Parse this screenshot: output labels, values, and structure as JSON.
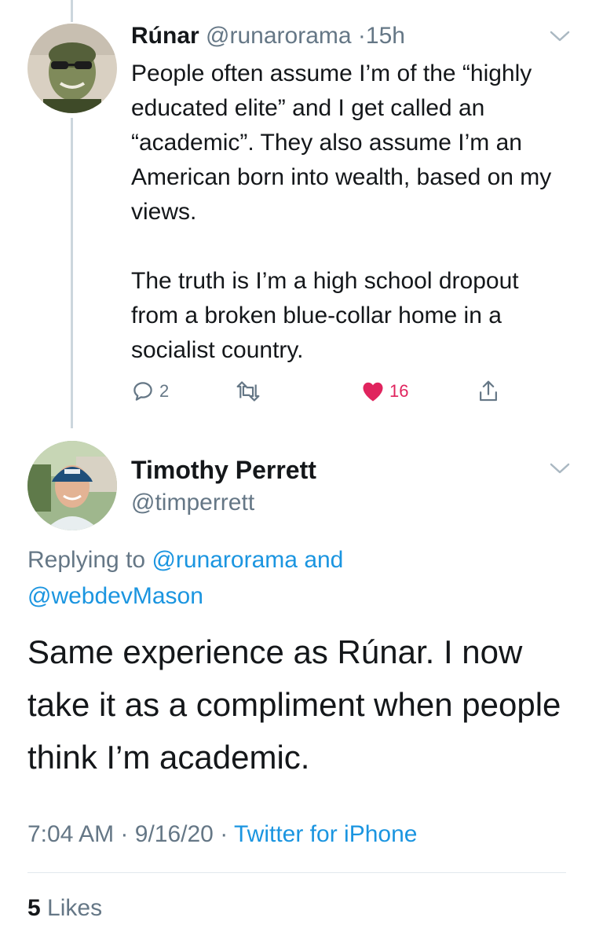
{
  "parent_tweet": {
    "author_name": "Rúnar",
    "author_handle": "@runarorama",
    "separator": "·",
    "time_ago": "15h",
    "paragraphs": [
      "People often assume I’m of the “highly educated elite” and I get called an “academic”. They also assume I’m an American born into wealth, based on my views.",
      "The truth is I’m a high school dropout from a broken blue-collar home in a socialist country."
    ],
    "reply_count": "2",
    "retweet_count": "",
    "like_count": "16",
    "avatar_icon": "runar-avatar"
  },
  "main_tweet": {
    "author_name": "Timothy Perrett",
    "author_handle": "@timperrett",
    "replying_prefix": "Replying to",
    "replying_to_1": "@runarorama",
    "replying_and": "and",
    "replying_to_2": "@webdevMason",
    "text": "Same experience as Rúnar. I now take it as a compliment when people think I’m academic.",
    "time": "7:04 AM",
    "separator": "·",
    "date": "9/16/20",
    "source": "Twitter for iPhone",
    "likes_count": "5",
    "likes_label": "Likes",
    "avatar_icon": "timothy-avatar"
  },
  "colors": {
    "text": "#14171a",
    "muted": "#657786",
    "link": "#1b95e0",
    "like": "#e0245e",
    "thread_line": "#ccd6dd"
  }
}
